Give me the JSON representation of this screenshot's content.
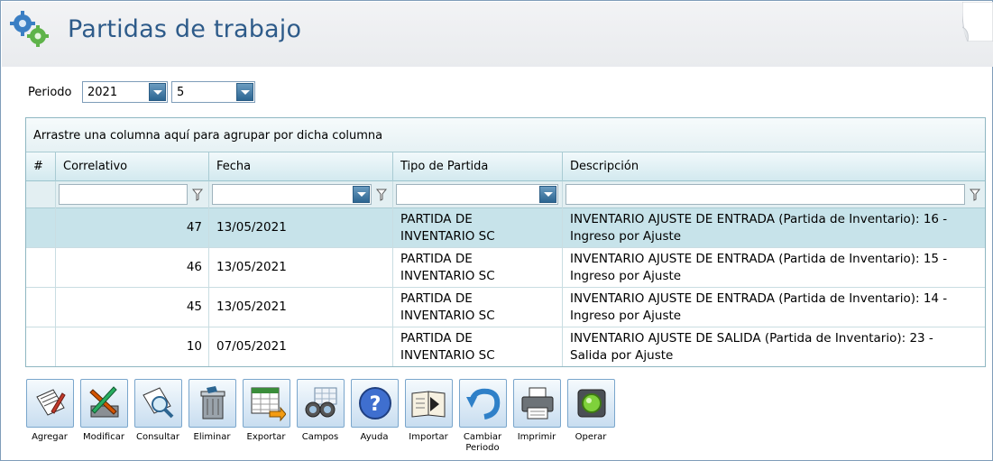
{
  "header": {
    "title": "Partidas de trabajo",
    "icon": "gears-icon"
  },
  "period": {
    "label": "Periodo",
    "year": "2021",
    "month": "5"
  },
  "grid": {
    "group_hint": "Arrastre una columna aquí para agrupar por dicha columna",
    "columns": [
      "#",
      "Correlativo",
      "Fecha",
      "Tipo de Partida",
      "Descripción"
    ],
    "rows": [
      {
        "correlativo": "47",
        "fecha": "13/05/2021",
        "tipo1": "PARTIDA DE",
        "tipo2": "INVENTARIO SC",
        "desc1": "INVENTARIO AJUSTE DE ENTRADA (Partida de Inventario): 16 -",
        "desc2": "Ingreso por Ajuste"
      },
      {
        "correlativo": "46",
        "fecha": "13/05/2021",
        "tipo1": "PARTIDA DE",
        "tipo2": "INVENTARIO SC",
        "desc1": "INVENTARIO AJUSTE DE ENTRADA (Partida de Inventario): 15 -",
        "desc2": "Ingreso por Ajuste"
      },
      {
        "correlativo": "45",
        "fecha": "13/05/2021",
        "tipo1": "PARTIDA DE",
        "tipo2": "INVENTARIO SC",
        "desc1": "INVENTARIO AJUSTE DE ENTRADA (Partida de Inventario): 14 -",
        "desc2": "Ingreso por Ajuste"
      },
      {
        "correlativo": "10",
        "fecha": "07/05/2021",
        "tipo1": "PARTIDA DE",
        "tipo2": "INVENTARIO SC",
        "desc1": "INVENTARIO AJUSTE DE SALIDA (Partida de Inventario): 23 -",
        "desc2": "Salida por Ajuste"
      }
    ]
  },
  "toolbar": {
    "agregar": "Agregar",
    "modificar": "Modificar",
    "consultar": "Consultar",
    "eliminar": "Eliminar",
    "exportar": "Exportar",
    "campos": "Campos",
    "ayuda": "Ayuda",
    "importar": "Importar",
    "cambiar1": "Cambiar",
    "cambiar2": "Periodo",
    "imprimir": "Imprimir",
    "operar": "Operar"
  },
  "colors": {
    "accent": "#2e5b8a",
    "selected_row": "#c7e3ea",
    "grid_border": "#8fb7c2"
  }
}
